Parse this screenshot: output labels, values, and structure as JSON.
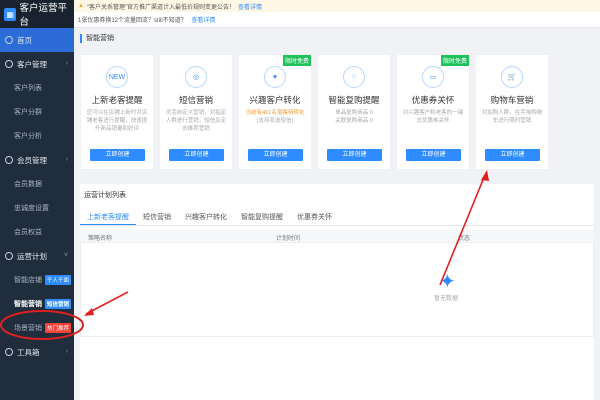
{
  "app": {
    "title": "客户运营平台",
    "logo_icon": "app-logo-icon"
  },
  "sidebar": {
    "home": "首页",
    "customer_mgmt": "客户管理",
    "customer_items": [
      "客户列表",
      "客户分群",
      "客户分析"
    ],
    "member_mgmt": "会员管理",
    "member_items": [
      "会员数据",
      "忠诚度设置",
      "会员权益"
    ],
    "ops_plan": "运营计划",
    "smart_shop": "智能店铺",
    "smart_shop_tag": "千人千面",
    "smart_marketing": "智能营销",
    "smart_marketing_tag": "短信营销",
    "scene_marketing": "场景营销",
    "scene_marketing_tag": "热门推荐",
    "toolbox": "工具箱"
  },
  "topbar": {
    "notice1": "“客户关系管理”官方推广渠道计入最低价规则变更公告！",
    "notice1_link": "查看详情",
    "notice2": "1张优惠券换12个流量回流？still不知道？",
    "notice2_link": "查看详情"
  },
  "smart_marketing": {
    "title": "智能营销",
    "cards": [
      {
        "title": "上新老客提醒",
        "desc": "您可以在店铺上新时对店铺老客进行提醒，快速提升新品销量和好评",
        "btn": "立即创建",
        "icon": "NEW"
      },
      {
        "title": "短信营销",
        "desc": "灵活自定义营销，对指定人群进行营销，短信及定向推荐营销",
        "btn": "立即创建",
        "icon": "◎"
      },
      {
        "title": "兴趣客户转化",
        "desc": "当前有461名潜客待转化",
        "desc2": "(支持发送短信)",
        "btn": "立即创建",
        "badge": "限时免费",
        "icon": "♥"
      },
      {
        "title": "智能复购提醒",
        "desc": "单品复购商品 0",
        "desc2": "关联复购商品 0",
        "btn": "立即创建",
        "icon": "♢"
      },
      {
        "title": "优惠券关怀",
        "desc": "对兴趣客户和老客的一键式优惠券关怀",
        "btn": "立即创建",
        "badge": "限时免费",
        "icon": "▭"
      },
      {
        "title": "购物车营销",
        "desc": "对加购人群，在手淘购物车进行限时营销",
        "btn": "立即创建",
        "icon": "🛒"
      }
    ]
  },
  "plan": {
    "title": "运营计划列表",
    "tabs": [
      "上新老客提醒",
      "短信营销",
      "兴趣客户转化",
      "智能复购提醒",
      "优惠券关怀"
    ],
    "headers": [
      "策略名称",
      "计划时间",
      "状态"
    ],
    "empty_text": "暂无数据"
  },
  "colors": {
    "accent": "#2f8cff",
    "sidebar_bg": "#1f2d3d",
    "badge_green": "#1ec15a",
    "annotation_red": "#e02020"
  }
}
